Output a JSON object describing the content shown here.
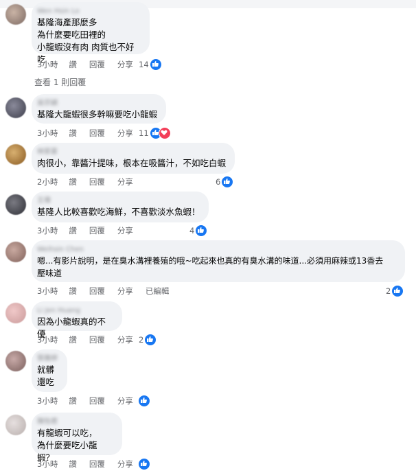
{
  "actions": {
    "like": "讚",
    "reply": "回覆",
    "share": "分享",
    "edited": "已編輯"
  },
  "view_replies": "查看 1 則回覆",
  "comments": [
    {
      "author": "Wen Hsin Lo",
      "text": "基隆海產那麼多\n為什麼要吃田裡的\n小龍蝦沒有肉 肉質也不好吃",
      "time": "3小時",
      "count": "14"
    },
    {
      "author": "吳宗穎",
      "text": "基隆大龍蝦很多幹嘛要吃小龍蝦",
      "time": "3小時",
      "count": "11"
    },
    {
      "author": "林家豪",
      "text": "肉很小，靠醬汁提味，根本在吸醬汁，不如吃白蝦",
      "time": "2小時",
      "count": "6"
    },
    {
      "author": "王偉",
      "text": "基隆人比較喜歡吃海鮮，不喜歡淡水魚蝦！",
      "time": "3小時",
      "count": "4"
    },
    {
      "author": "Weihsin Chen",
      "text": "嗯...有影片說明，是在臭水溝裡養殖的哦~吃起來也真的有臭水溝的味道...必須用麻辣或13香去\n壓味道",
      "time": "3小時",
      "count": "2"
    },
    {
      "author": "Li Jen Huang",
      "text": "因為小龍蝦真的不優",
      "time": "3小時",
      "count": "2"
    },
    {
      "author": "張雅婷",
      "text": "就髒\n還吃",
      "time": "3小時",
      "count": ""
    },
    {
      "author": "陳怡君",
      "text": "有龍蝦可以吃，\n為什麼要吃小龍蝦？",
      "time": "3小時",
      "count": ""
    }
  ],
  "icons": {
    "like": "thumbs-up-icon",
    "love": "heart-icon"
  },
  "colors": {
    "like": "#1877f2",
    "love": "#f33e58",
    "bubble": "#f0f2f5",
    "meta": "#65676b"
  }
}
